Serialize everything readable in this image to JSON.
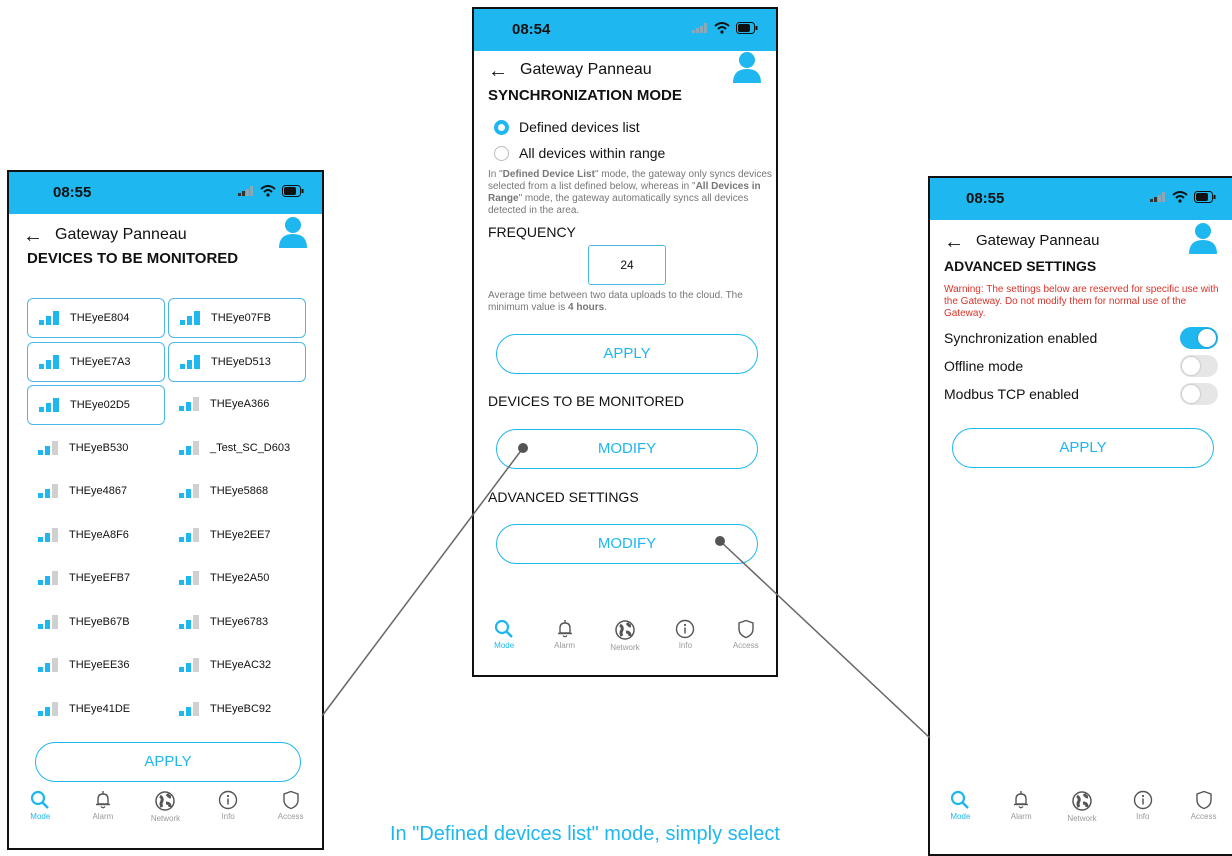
{
  "colors": {
    "accent": "#1eb7f0",
    "warning": "#d9342b",
    "selected_border": "#4cb8e6"
  },
  "left": {
    "time": "08:55",
    "gateway_title": "Gateway Panneau",
    "section_title": "DEVICES TO BE MONITORED",
    "devices": [
      {
        "name": "THEyeE804",
        "selected": true
      },
      {
        "name": "THEye07FB",
        "selected": true
      },
      {
        "name": "THEyeE7A3",
        "selected": true
      },
      {
        "name": "THEyeD513",
        "selected": true
      },
      {
        "name": "THEye02D5",
        "selected": true
      },
      {
        "name": "THEyeA366",
        "selected": false
      },
      {
        "name": "THEyeB530",
        "selected": false
      },
      {
        "name": "_Test_SC_D603",
        "selected": false
      },
      {
        "name": "THEye4867",
        "selected": false
      },
      {
        "name": "THEye5868",
        "selected": false
      },
      {
        "name": "THEyeA8F6",
        "selected": false
      },
      {
        "name": "THEye2EE7",
        "selected": false
      },
      {
        "name": "THEyeEFB7",
        "selected": false
      },
      {
        "name": "THEye2A50",
        "selected": false
      },
      {
        "name": "THEyeB67B",
        "selected": false
      },
      {
        "name": "THEye6783",
        "selected": false
      },
      {
        "name": "THEyeEE36",
        "selected": false
      },
      {
        "name": "THEyeAC32",
        "selected": false
      },
      {
        "name": "THEye41DE",
        "selected": false
      },
      {
        "name": "THEyeBC92",
        "selected": false
      }
    ],
    "apply_label": "APPLY"
  },
  "middle": {
    "time": "08:54",
    "gateway_title": "Gateway Panneau",
    "sync_title": "SYNCHRONIZATION MODE",
    "options": [
      {
        "label": "Defined devices list",
        "checked": true
      },
      {
        "label": "All devices within range",
        "checked": false
      }
    ],
    "description": {
      "p1": "In \"",
      "b1": "Defined Device List",
      "p2": "\" mode, the gateway only syncs devices selected from a list defined below, whereas in \"",
      "b2": "All Devices in Range",
      "p3": "\" mode, the gateway automatically syncs all devices detected in the area."
    },
    "frequency_label": "FREQUENCY",
    "frequency_value": "24",
    "frequency_note_a": "Average time between two data uploads to the cloud. The minimum value is ",
    "frequency_note_b": "4 hours",
    "frequency_note_c": ".",
    "apply_label": "APPLY",
    "devices_label": "DEVICES TO BE MONITORED",
    "modify_label": "MODIFY",
    "advanced_label": "ADVANCED SETTINGS",
    "modify2_label": "MODIFY"
  },
  "right": {
    "time": "08:55",
    "gateway_title": "Gateway Panneau",
    "section_title": "ADVANCED SETTINGS",
    "warning": "Warning: The settings below are reserved for specific use with the Gateway. Do not modify them for normal use of the Gateway.",
    "settings": [
      {
        "label": "Synchronization enabled",
        "on": true
      },
      {
        "label": "Offline mode",
        "on": false
      },
      {
        "label": "Modbus TCP enabled",
        "on": false
      }
    ],
    "apply_label": "APPLY"
  },
  "nav": [
    {
      "label": "Mode",
      "icon": "search-icon",
      "active": true
    },
    {
      "label": "Alarm",
      "icon": "bell-icon",
      "active": false
    },
    {
      "label": "Network",
      "icon": "globe-icon",
      "active": false
    },
    {
      "label": "Info",
      "icon": "info-icon",
      "active": false
    },
    {
      "label": "Access",
      "icon": "shield-icon",
      "active": false
    }
  ],
  "caption": "In \"Defined devices list\" mode, simply select"
}
